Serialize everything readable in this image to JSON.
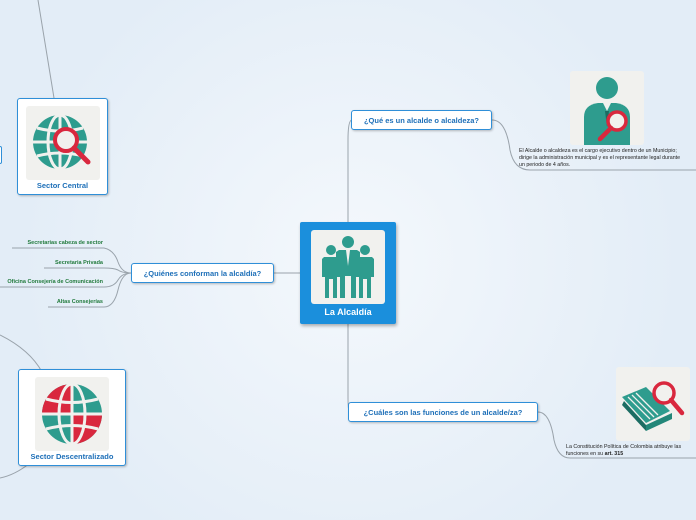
{
  "central": {
    "label": "La Alcaldía",
    "icon": "people-group-icon"
  },
  "topics": {
    "que_es": "¿Qué es un alcalde o alcaldeza?",
    "quienes": "¿Quiénes conforman la alcaldía?",
    "funciones": "¿Cuáles son las funciones de un alcalde/za?"
  },
  "sector_central": {
    "label": "Sector Central",
    "icon": "globe-search-icon"
  },
  "sector_descentralizado": {
    "label": "Sector Descentralizado",
    "icon": "globe-red-icon"
  },
  "leaves": [
    "Secretarias cabeza de sector",
    "Secretaria Privada",
    "Oficina Consejería de Comunicación",
    "Altas Consejerías"
  ],
  "notes": {
    "que_es": "El Alcalde o alcaldeza es el cargo ejecutivo dentro de un Municipio; dirige la administración municipal y es el representante legal durante un periodo de 4 años.",
    "funciones_text": "La Constitución Política de Colombia atribuye las funciones en su",
    "funciones_bold": "art. 315"
  },
  "colors": {
    "accent": "#2f8fd8",
    "central": "#1b8fdc",
    "leaf": "#217a3c",
    "teal": "#2e9c8e",
    "red": "#d9283e"
  }
}
